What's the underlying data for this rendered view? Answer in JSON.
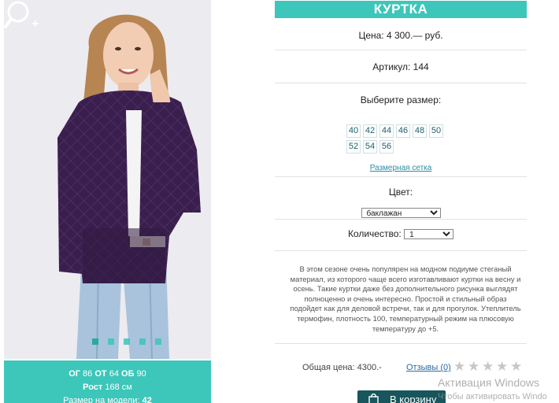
{
  "product": {
    "title": "КУРТКА",
    "price": "Цена: 4 300.— руб.",
    "article": "Артикул: 144",
    "choose_size_label": "Выберите размер:",
    "sizes": [
      "40",
      "42",
      "44",
      "46",
      "48",
      "50",
      "52",
      "54",
      "56"
    ],
    "size_chart_link": "Размерная сетка",
    "color_label": "Цвет:",
    "color_value": "баклажан",
    "quantity_label": "Количество:",
    "quantity_value": "1",
    "description": "В этом сезоне очень популярен на модном подиуме стеганый материал, из которого чаще всего изготавливают куртки на весну и осень. Такие куртки даже без дополнительного рисунка выглядят полноценно и очень интересно. Простой и стильный образ подойдет как для деловой встречи, так и для прогулок. Утеплитель термофин, плотность 100, температурный режим на плюсовую температуру до +5.",
    "total": "Общая цена: 4300.-",
    "reviews_link": "Отзывы (0)",
    "rating_stars": 0,
    "cart_button": "В корзину"
  },
  "model_info": {
    "og_label": "ОГ",
    "og_value": "86",
    "ot_label": "ОТ",
    "ot_value": "64",
    "ob_label": "ОБ",
    "ob_value": "90",
    "height_label": "Рост",
    "height_value": "168 см",
    "size_label": "Размер на модели:",
    "size_value": "42"
  },
  "gallery": {
    "slides": 5,
    "active_slide": 1
  },
  "os_watermark": {
    "line1": "Активация Windows",
    "line2": "Чтобы активировать Windo"
  },
  "colors": {
    "accent": "#3dc6ba",
    "cart_bg": "#17565d",
    "jacket": "#3b1f4f"
  }
}
